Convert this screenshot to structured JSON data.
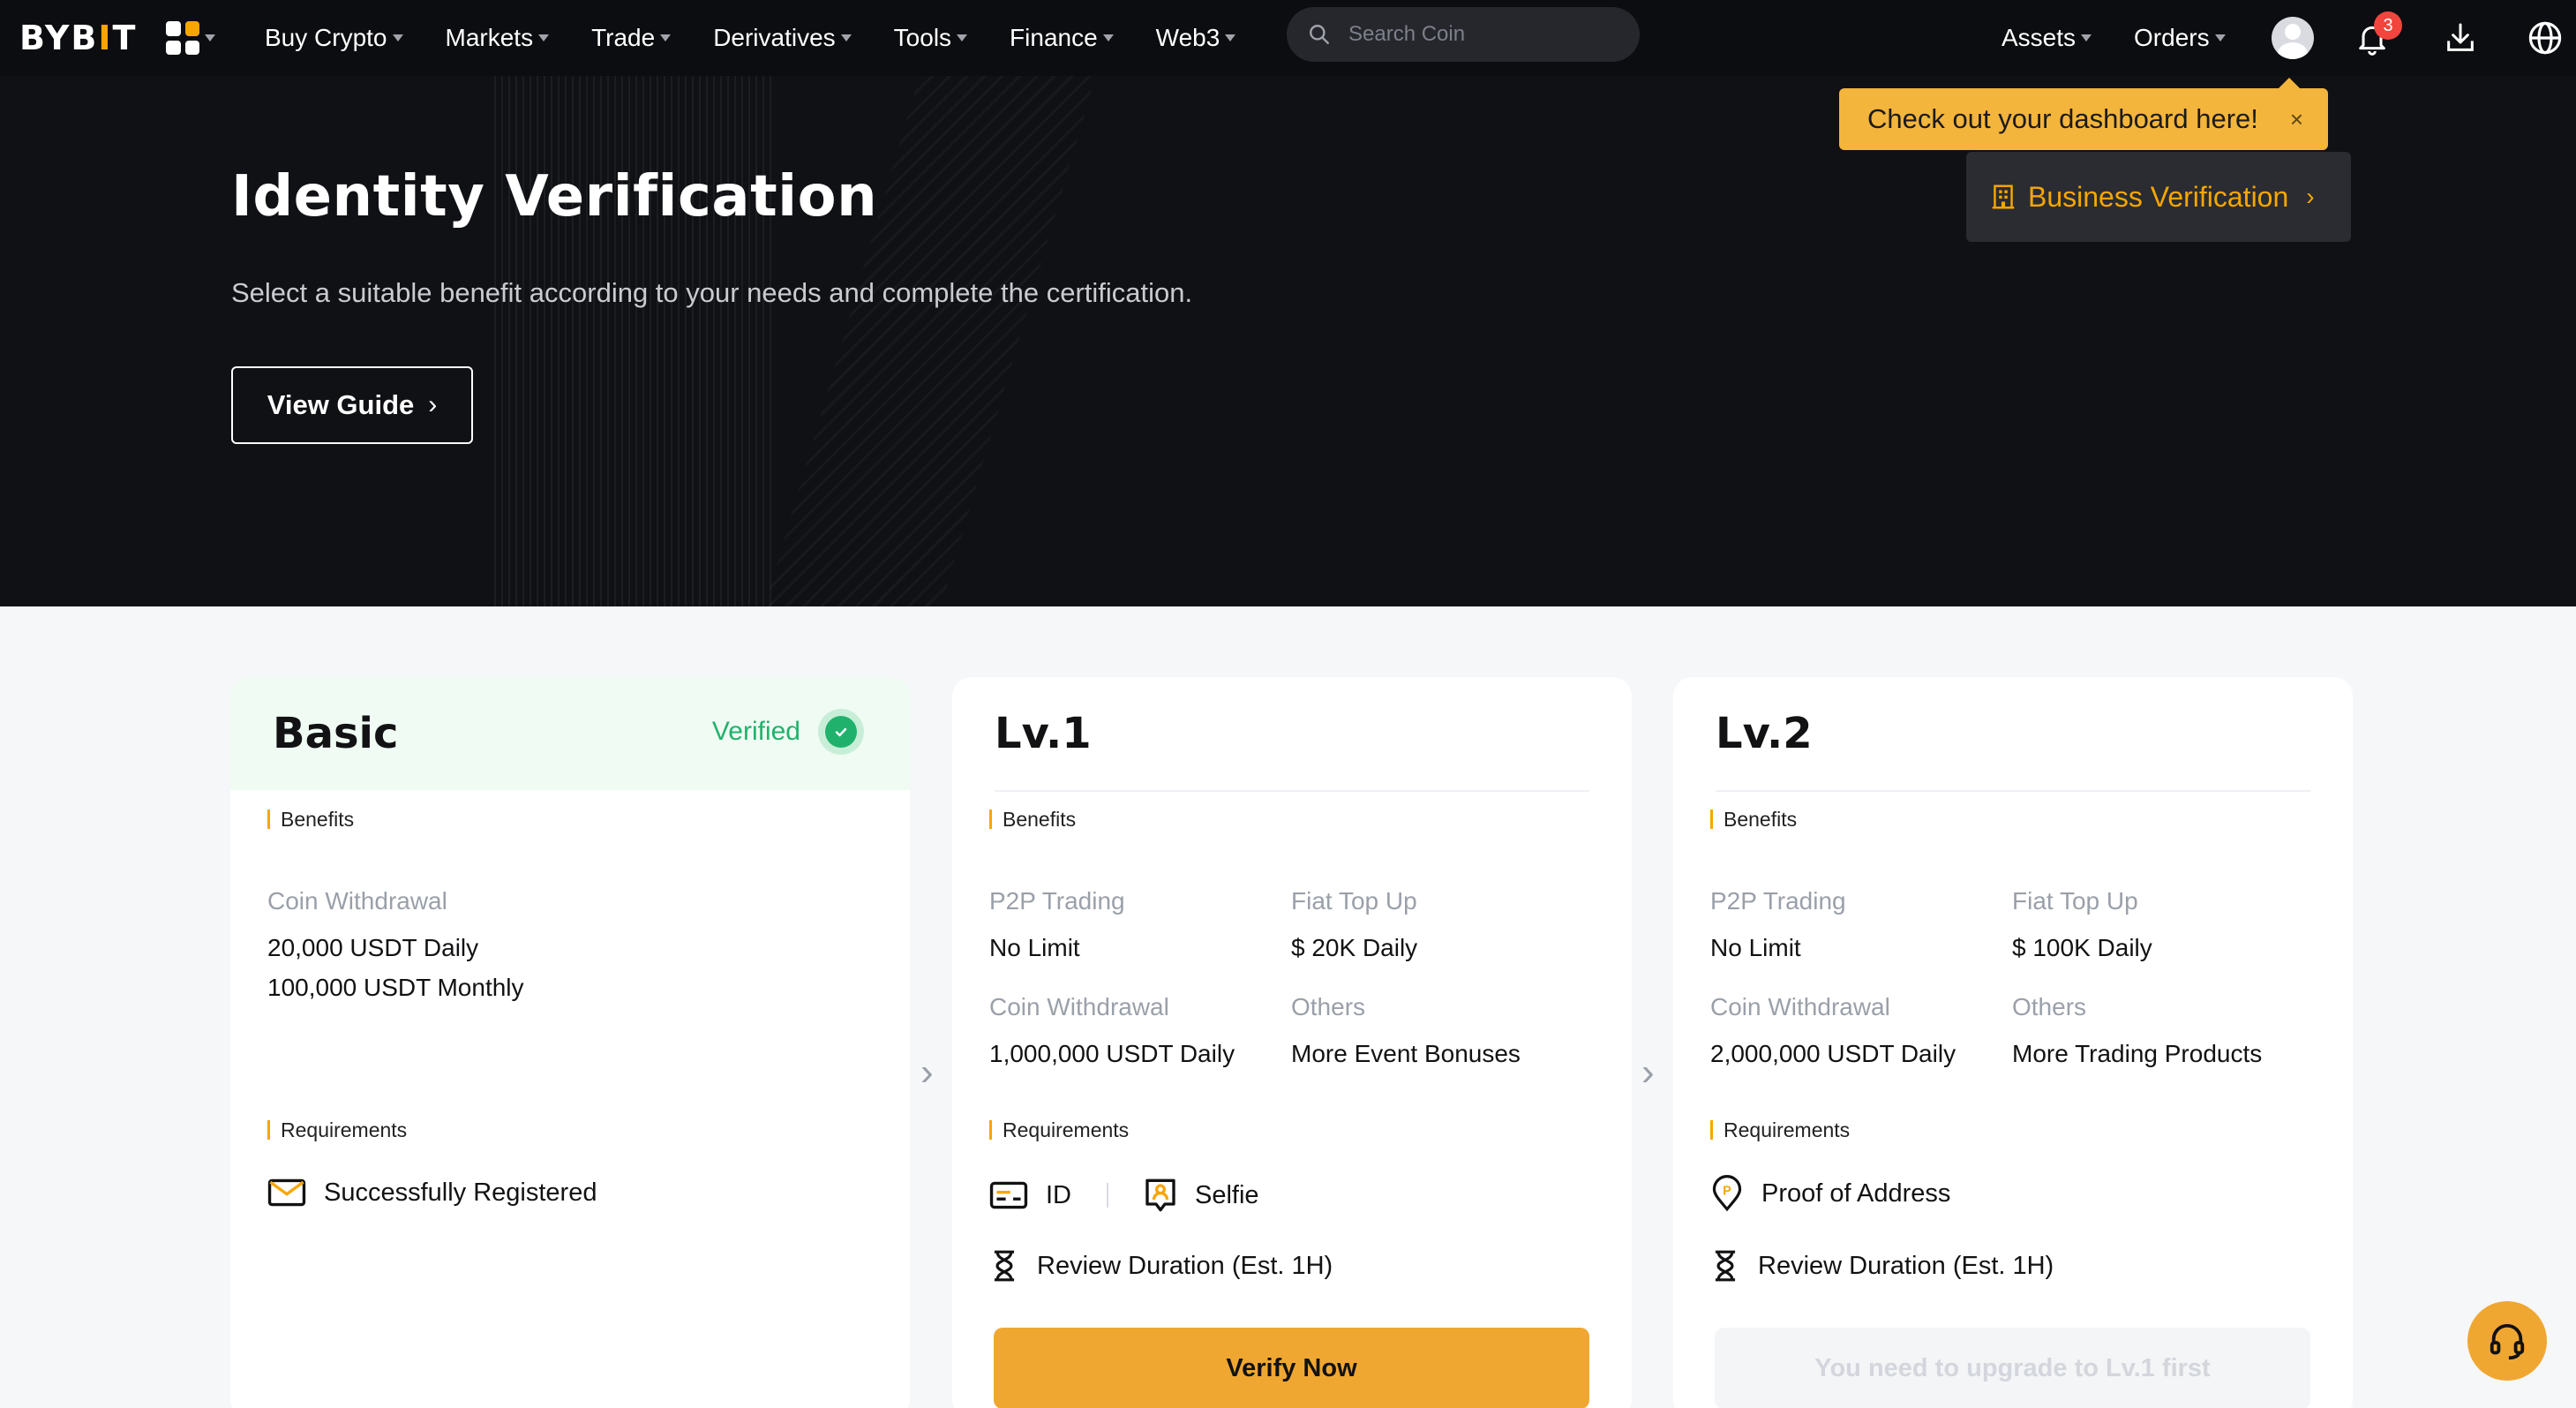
{
  "nav": {
    "logo": {
      "left": "BYB",
      "mid": "I",
      "right": "T"
    },
    "menu": [
      "Buy Crypto",
      "Markets",
      "Trade",
      "Derivatives",
      "Tools",
      "Finance",
      "Web3"
    ],
    "search_placeholder": "Search Coin",
    "assets_label": "Assets",
    "orders_label": "Orders",
    "notification_count": "3"
  },
  "tooltip": {
    "text": "Check out your dashboard here!",
    "close": "×"
  },
  "business": {
    "label": "Business Verification"
  },
  "hero": {
    "title": "Identity Verification",
    "subtitle": "Select a suitable benefit according to your needs and complete the certification.",
    "guide_label": "View Guide"
  },
  "cards": [
    {
      "title": "Basic",
      "status": "Verified",
      "benefits_label": "Benefits",
      "benefits": [
        {
          "key": "Coin Withdrawal",
          "values": [
            "20,000 USDT Daily",
            "100,000 USDT Monthly"
          ]
        }
      ],
      "requirements_label": "Requirements",
      "requirements": [
        "Successfully Registered"
      ]
    },
    {
      "title": "Lv.1",
      "benefits_label": "Benefits",
      "benefits": [
        {
          "key": "P2P Trading",
          "values": [
            "No Limit"
          ]
        },
        {
          "key": "Fiat Top Up",
          "values": [
            "$ 20K Daily"
          ]
        },
        {
          "key": "Coin Withdrawal",
          "values": [
            "1,000,000 USDT Daily"
          ]
        },
        {
          "key": "Others",
          "values": [
            "More Event Bonuses"
          ]
        }
      ],
      "requirements_label": "Requirements",
      "requirements": [
        "ID",
        "Selfie"
      ],
      "review": "Review Duration (Est. 1H)",
      "action": "Verify Now"
    },
    {
      "title": "Lv.2",
      "benefits_label": "Benefits",
      "benefits": [
        {
          "key": "P2P Trading",
          "values": [
            "No Limit"
          ]
        },
        {
          "key": "Fiat Top Up",
          "values": [
            "$ 100K Daily"
          ]
        },
        {
          "key": "Coin Withdrawal",
          "values": [
            "2,000,000 USDT Daily"
          ]
        },
        {
          "key": "Others",
          "values": [
            "More Trading Products"
          ]
        }
      ],
      "requirements_label": "Requirements",
      "requirements": [
        "Proof of Address"
      ],
      "review": "Review Duration (Est. 1H)",
      "action": "You need to upgrade to Lv.1 first"
    }
  ],
  "icons": {
    "search": "search-icon",
    "apps": "apps-grid-icon",
    "avatar": "avatar-icon",
    "bell": "bell-icon",
    "download": "download-icon",
    "globe": "globe-icon",
    "support": "headset-icon",
    "building": "building-icon"
  },
  "colors": {
    "brand": "#f7a600",
    "verified": "#20b26c",
    "action": "#f0a732"
  }
}
